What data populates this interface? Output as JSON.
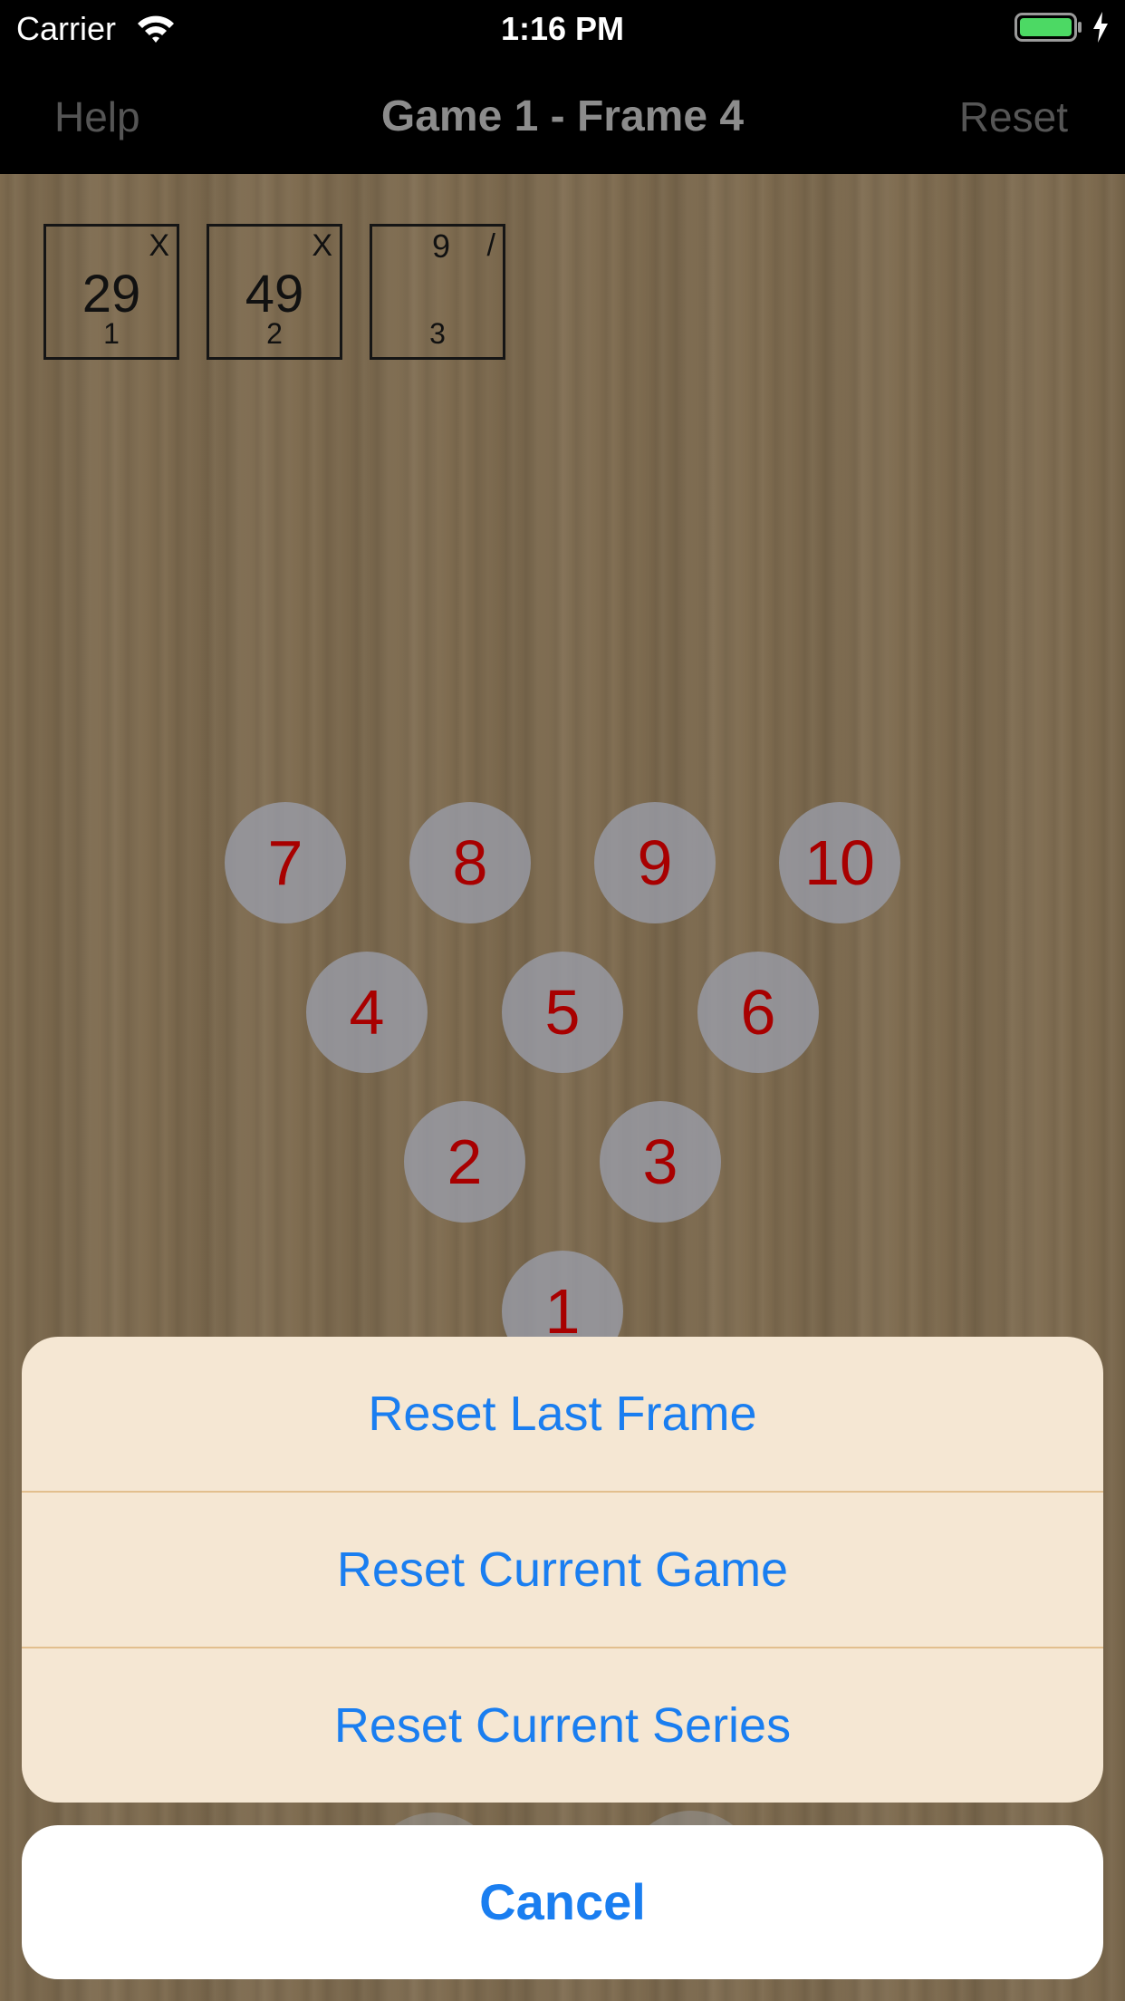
{
  "status_bar": {
    "carrier": "Carrier",
    "time": "1:16 PM"
  },
  "nav": {
    "left": "Help",
    "title": "Game 1 - Frame 4",
    "right": "Reset"
  },
  "frames": [
    {
      "number": "1",
      "score": "29",
      "mark": "X",
      "ball1": ""
    },
    {
      "number": "2",
      "score": "49",
      "mark": "X",
      "ball1": ""
    },
    {
      "number": "3",
      "score": "",
      "mark": "/",
      "ball1": "9"
    }
  ],
  "pins": [
    "1",
    "2",
    "3",
    "4",
    "5",
    "6",
    "7",
    "8",
    "9",
    "10"
  ],
  "action_sheet": {
    "actions": [
      "Reset Last Frame",
      "Reset Current Game",
      "Reset Current Series"
    ],
    "cancel": "Cancel"
  },
  "colors": {
    "accent": "#1a7ef0",
    "pin_number": "#a80000",
    "wood": "#7e6b4f",
    "battery": "#4cd964"
  },
  "icons": [
    "wifi-icon",
    "battery-icon",
    "charging-bolt-icon"
  ]
}
